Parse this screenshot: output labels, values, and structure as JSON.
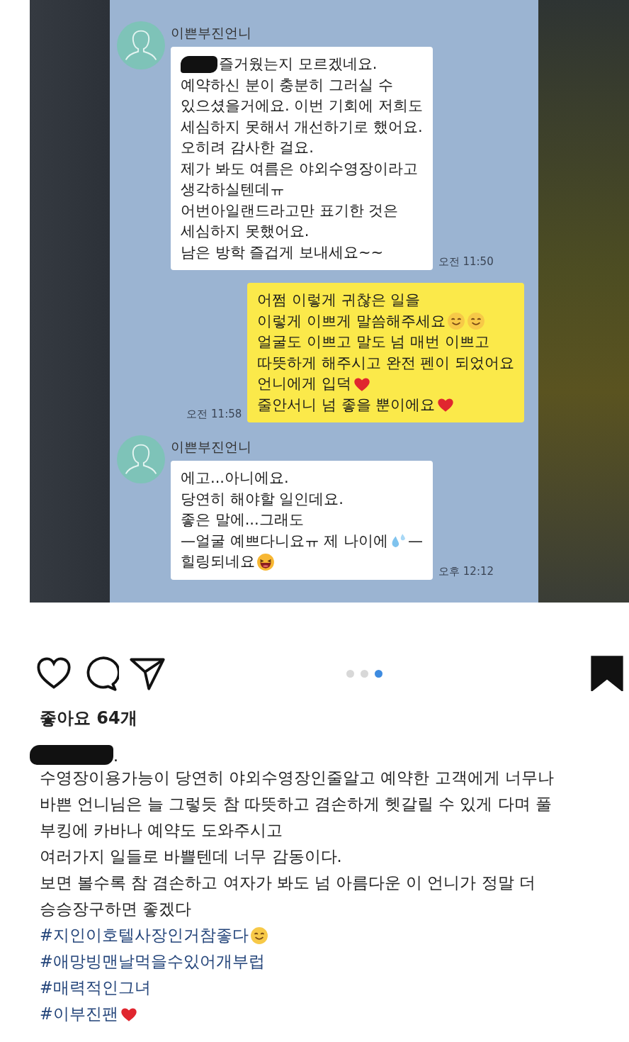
{
  "chat": {
    "messages": [
      {
        "kind": "received",
        "sender": "이쁜부진언니",
        "time": "오전 11:50",
        "lines": [
          {
            "redacted": true,
            "text": "즐거웠는지 모르겠네요."
          },
          {
            "text": "예약하신 분이 충분히 그러실 수"
          },
          {
            "text": "있으셨을거에요. 이번 기회에 저희도"
          },
          {
            "text": "세심하지 못해서 개선하기로 했어요."
          },
          {
            "text": "오히려 감사한 걸요."
          },
          {
            "text": "제가 봐도 여름은 야외수영장이라고"
          },
          {
            "text": "생각하실텐데ㅠ"
          },
          {
            "text": "어번아일랜드라고만 표기한 것은"
          },
          {
            "text": "세심하지 못했어요."
          },
          {
            "text": "남은 방학 즐겁게 보내세요~~"
          }
        ]
      },
      {
        "kind": "sent",
        "time": "오전 11:58",
        "lines": [
          {
            "text": "어쩜 이렇게 귀찮은 일을"
          },
          {
            "text": "이렇게 이쁘게 말씀해주세요",
            "emojis": [
              {
                "kind": "smile"
              },
              {
                "kind": "smile"
              }
            ]
          },
          {
            "text": "얼굴도 이쁘고 말도 넘 매번 이쁘고"
          },
          {
            "text": "따뜻하게 해주시고 완전 펜이 되었어요"
          },
          {
            "text": "언니에게 입덕",
            "emojis": [
              {
                "kind": "heart"
              }
            ]
          },
          {
            "text": "줄안서니 넘 좋을 뿐이에요",
            "emojis": [
              {
                "kind": "heart"
              }
            ]
          }
        ]
      },
      {
        "kind": "received",
        "sender": "이쁜부진언니",
        "time": "오후 12:12",
        "lines": [
          {
            "text": "에고...아니에요."
          },
          {
            "text": "당연히 해야할 일인데요."
          },
          {
            "text": "좋은 말에...그래도"
          },
          {
            "text": "—얼굴 예쁘다니요ㅠ 제 나이에",
            "emojis": [
              {
                "kind": "droplets"
              }
            ],
            "tail": "—"
          },
          {
            "text": "힐링되네요",
            "emojis": [
              {
                "kind": "laugh"
              }
            ]
          }
        ]
      }
    ]
  },
  "post": {
    "carousel": [
      {
        "selected": false
      },
      {
        "selected": false
      },
      {
        "selected": true
      }
    ],
    "saved": true,
    "likes": "좋아요 64개",
    "caption": {
      "author_redacted": true,
      "author_suffix": ".",
      "lines": [
        {
          "text": "수영장이용가능이 당연히 야외수영장인줄알고 예약한 고객에게 너무나"
        },
        {
          "text": "바쁜 언니님은 늘 그렇듯 참 따뜻하고 겸손하게 헷갈릴 수 있게 다며 풀"
        },
        {
          "text": "부킹에 카바나 예약도 도와주시고"
        },
        {
          "text": "여러가지 일들로 바쁠텐데 너무 감동이다."
        },
        {
          "text": "보면 볼수록 참 겸손하고 여자가 봐도 넘 아름다운 이 언니가 정말 더"
        },
        {
          "text": "승승장구하면 좋겠다"
        }
      ],
      "hashtags": [
        {
          "text": "#지인이호텔사장인거참좋다",
          "emojis": [
            {
              "kind": "smile"
            }
          ]
        },
        {
          "text": "#애망빙맨날먹을수있어개부럽"
        },
        {
          "text": "#매력적인그녀"
        },
        {
          "text": "#이부진팬",
          "emojis": [
            {
              "kind": "heart"
            }
          ]
        }
      ]
    }
  }
}
